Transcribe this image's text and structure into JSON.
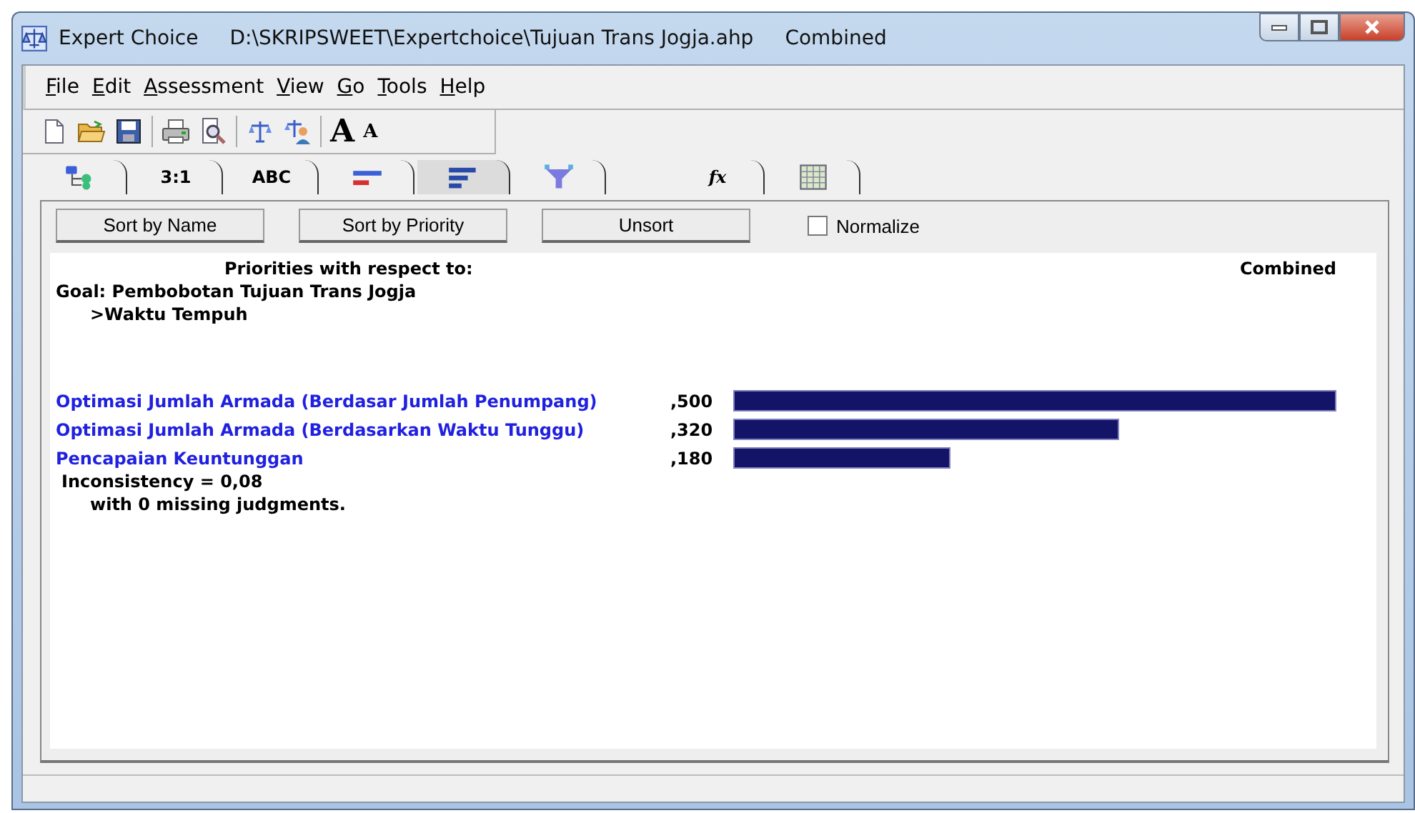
{
  "window": {
    "title": "Expert Choice",
    "document": "D:\\SKRIPSWEET\\Expertchoice\\Tujuan Trans Jogja.ahp",
    "mode": "Combined"
  },
  "menu": [
    "File",
    "Edit",
    "Assessment",
    "View",
    "Go",
    "Tools",
    "Help"
  ],
  "toolbar": [
    {
      "kind": "new"
    },
    {
      "kind": "open"
    },
    {
      "kind": "save"
    },
    {
      "kind": "sep"
    },
    {
      "kind": "print"
    },
    {
      "kind": "preview"
    },
    {
      "kind": "sep"
    },
    {
      "kind": "balance"
    },
    {
      "kind": "balance-person"
    },
    {
      "kind": "sep"
    },
    {
      "kind": "font-large",
      "label": "A"
    },
    {
      "kind": "font-small",
      "label": "A"
    }
  ],
  "tabs": [
    {
      "kind": "tree",
      "selected": false
    },
    {
      "kind": "text",
      "label": "3:1",
      "selected": false
    },
    {
      "kind": "text",
      "label": "ABC",
      "selected": false
    },
    {
      "kind": "bars-color",
      "selected": false
    },
    {
      "kind": "bars",
      "selected": true
    },
    {
      "kind": "funnel",
      "selected": false
    },
    {
      "kind": "formula",
      "label": "fx",
      "selected": false
    },
    {
      "kind": "grid",
      "selected": false
    }
  ],
  "actions": [
    "Sort by Name",
    "Sort by Priority",
    "Unsort"
  ],
  "normalize": {
    "label": "Normalize",
    "checked": false
  },
  "report": {
    "heading": "Priorities with respect to:",
    "mode": "Combined",
    "goal": "Goal: Pembobotan Tujuan Trans Jogja",
    "node": ">Waktu Tempuh",
    "items": [
      {
        "name": "Optimasi Jumlah Armada (Berdasar Jumlah Penumpang)",
        "value": ",500"
      },
      {
        "name": "Optimasi Jumlah Armada (Berdasarkan Waktu Tunggu)",
        "value": ",320"
      },
      {
        "name": "Pencapaian Keuntunggan",
        "value": ",180"
      }
    ],
    "inconsistency": "Inconsistency = 0,08",
    "missing": "with 0  missing judgments."
  }
}
